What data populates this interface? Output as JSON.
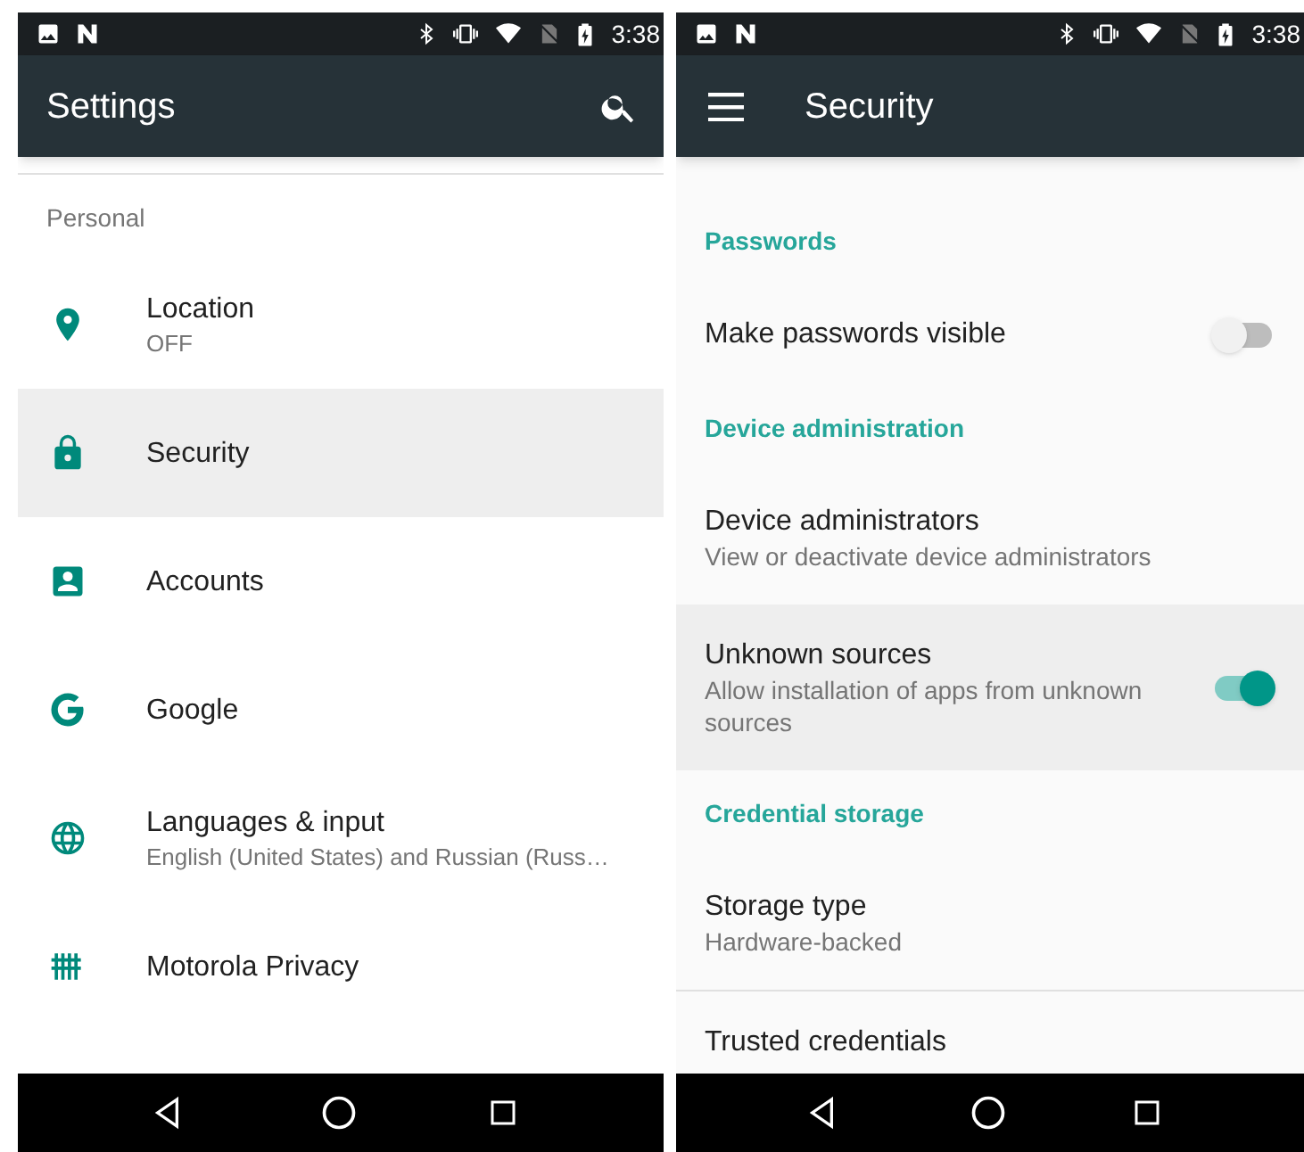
{
  "screens": [
    {
      "status_bar": {
        "time": "3:38"
      },
      "app_bar": {
        "title": "Settings",
        "menu_button": false,
        "search": true
      },
      "items": [
        {
          "kind": "header",
          "title": "Personal"
        },
        {
          "kind": "item",
          "title": "Location",
          "summary": "OFF",
          "selected": false
        },
        {
          "kind": "item",
          "title": "Security",
          "selected": true
        },
        {
          "kind": "item",
          "title": "Accounts",
          "selected": false
        },
        {
          "kind": "item",
          "title": "Google",
          "selected": false
        },
        {
          "kind": "item",
          "title": "Languages & input",
          "summary": "English (United States) and Russian (Russ…",
          "selected": false
        },
        {
          "kind": "item",
          "title": "Motorola Privacy",
          "selected": false
        }
      ]
    },
    {
      "status_bar": {
        "time": "3:38"
      },
      "app_bar": {
        "title": "Security",
        "menu_button": true,
        "search": false
      },
      "items": [
        {
          "kind": "header",
          "title": "Passwords"
        },
        {
          "kind": "toggle",
          "title": "Make passwords visible",
          "on": false,
          "selected": false
        },
        {
          "kind": "header",
          "title": "Device administration"
        },
        {
          "kind": "item",
          "title": "Device administrators",
          "summary": "View or deactivate device administrators",
          "selected": false
        },
        {
          "kind": "toggle",
          "title": "Unknown sources",
          "summary": "Allow installation of apps from unknown sources",
          "on": true,
          "selected": true
        },
        {
          "kind": "header",
          "title": "Credential storage"
        },
        {
          "kind": "item",
          "title": "Storage type",
          "summary": "Hardware-backed",
          "selected": false,
          "divider": true
        },
        {
          "kind": "item",
          "title": "Trusted credentials",
          "selected": false
        }
      ]
    }
  ]
}
